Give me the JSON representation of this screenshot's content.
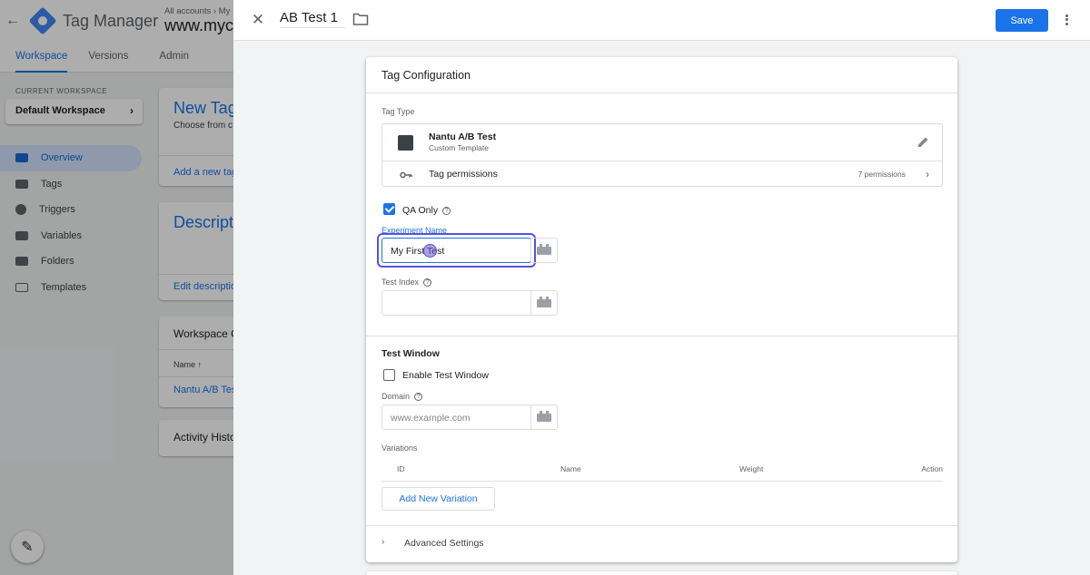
{
  "background": {
    "app_name": "Tag Manager",
    "breadcrumb": "All accounts › My",
    "container_name": "www.myco",
    "tabs": [
      "Workspace",
      "Versions",
      "Admin"
    ],
    "current_workspace_label": "CURRENT WORKSPACE",
    "current_workspace": "Default Workspace",
    "nav": [
      {
        "label": "Overview",
        "icon": "overview-icon"
      },
      {
        "label": "Tags",
        "icon": "tag-icon"
      },
      {
        "label": "Triggers",
        "icon": "trigger-icon"
      },
      {
        "label": "Variables",
        "icon": "variables-icon"
      },
      {
        "label": "Folders",
        "icon": "folder-icon"
      },
      {
        "label": "Templates",
        "icon": "template-icon"
      }
    ],
    "new_tag": {
      "title": "New Tag",
      "subtitle": "Choose from c",
      "link": "Add a new tag"
    },
    "description": {
      "title": "Descript",
      "link": "Edit descriptio"
    },
    "workspace_changes": {
      "title": "Workspace C",
      "column": "Name ↑",
      "row": "Nantu A/B Test"
    },
    "activity": {
      "title": "Activity Histo"
    }
  },
  "panel": {
    "tag_name": "AB Test 1",
    "save_label": "Save"
  },
  "config": {
    "title": "Tag Configuration",
    "tag_type_label": "Tag Type",
    "template_name": "Nantu A/B Test",
    "template_subtitle": "Custom Template",
    "permissions_label": "Tag permissions",
    "permissions_count": "7 permissions",
    "qa_only_label": "QA Only",
    "qa_only_checked": true,
    "experiment_name_label": "Experiment Name",
    "experiment_name_value": "My First Test",
    "test_index_label": "Test Index",
    "test_index_value": "",
    "test_window_title": "Test Window",
    "enable_test_window_label": "Enable Test Window",
    "enable_test_window_checked": false,
    "domain_label": "Domain",
    "domain_placeholder": "www.example.com",
    "variations_label": "Variations",
    "variation_columns": [
      "ID",
      "Name",
      "Weight",
      "Action"
    ],
    "add_variation_label": "Add New Variation",
    "advanced_settings_label": "Advanced Settings"
  },
  "colors": {
    "accent": "#1a73e8",
    "focus_ring": "#5b4fe0"
  }
}
